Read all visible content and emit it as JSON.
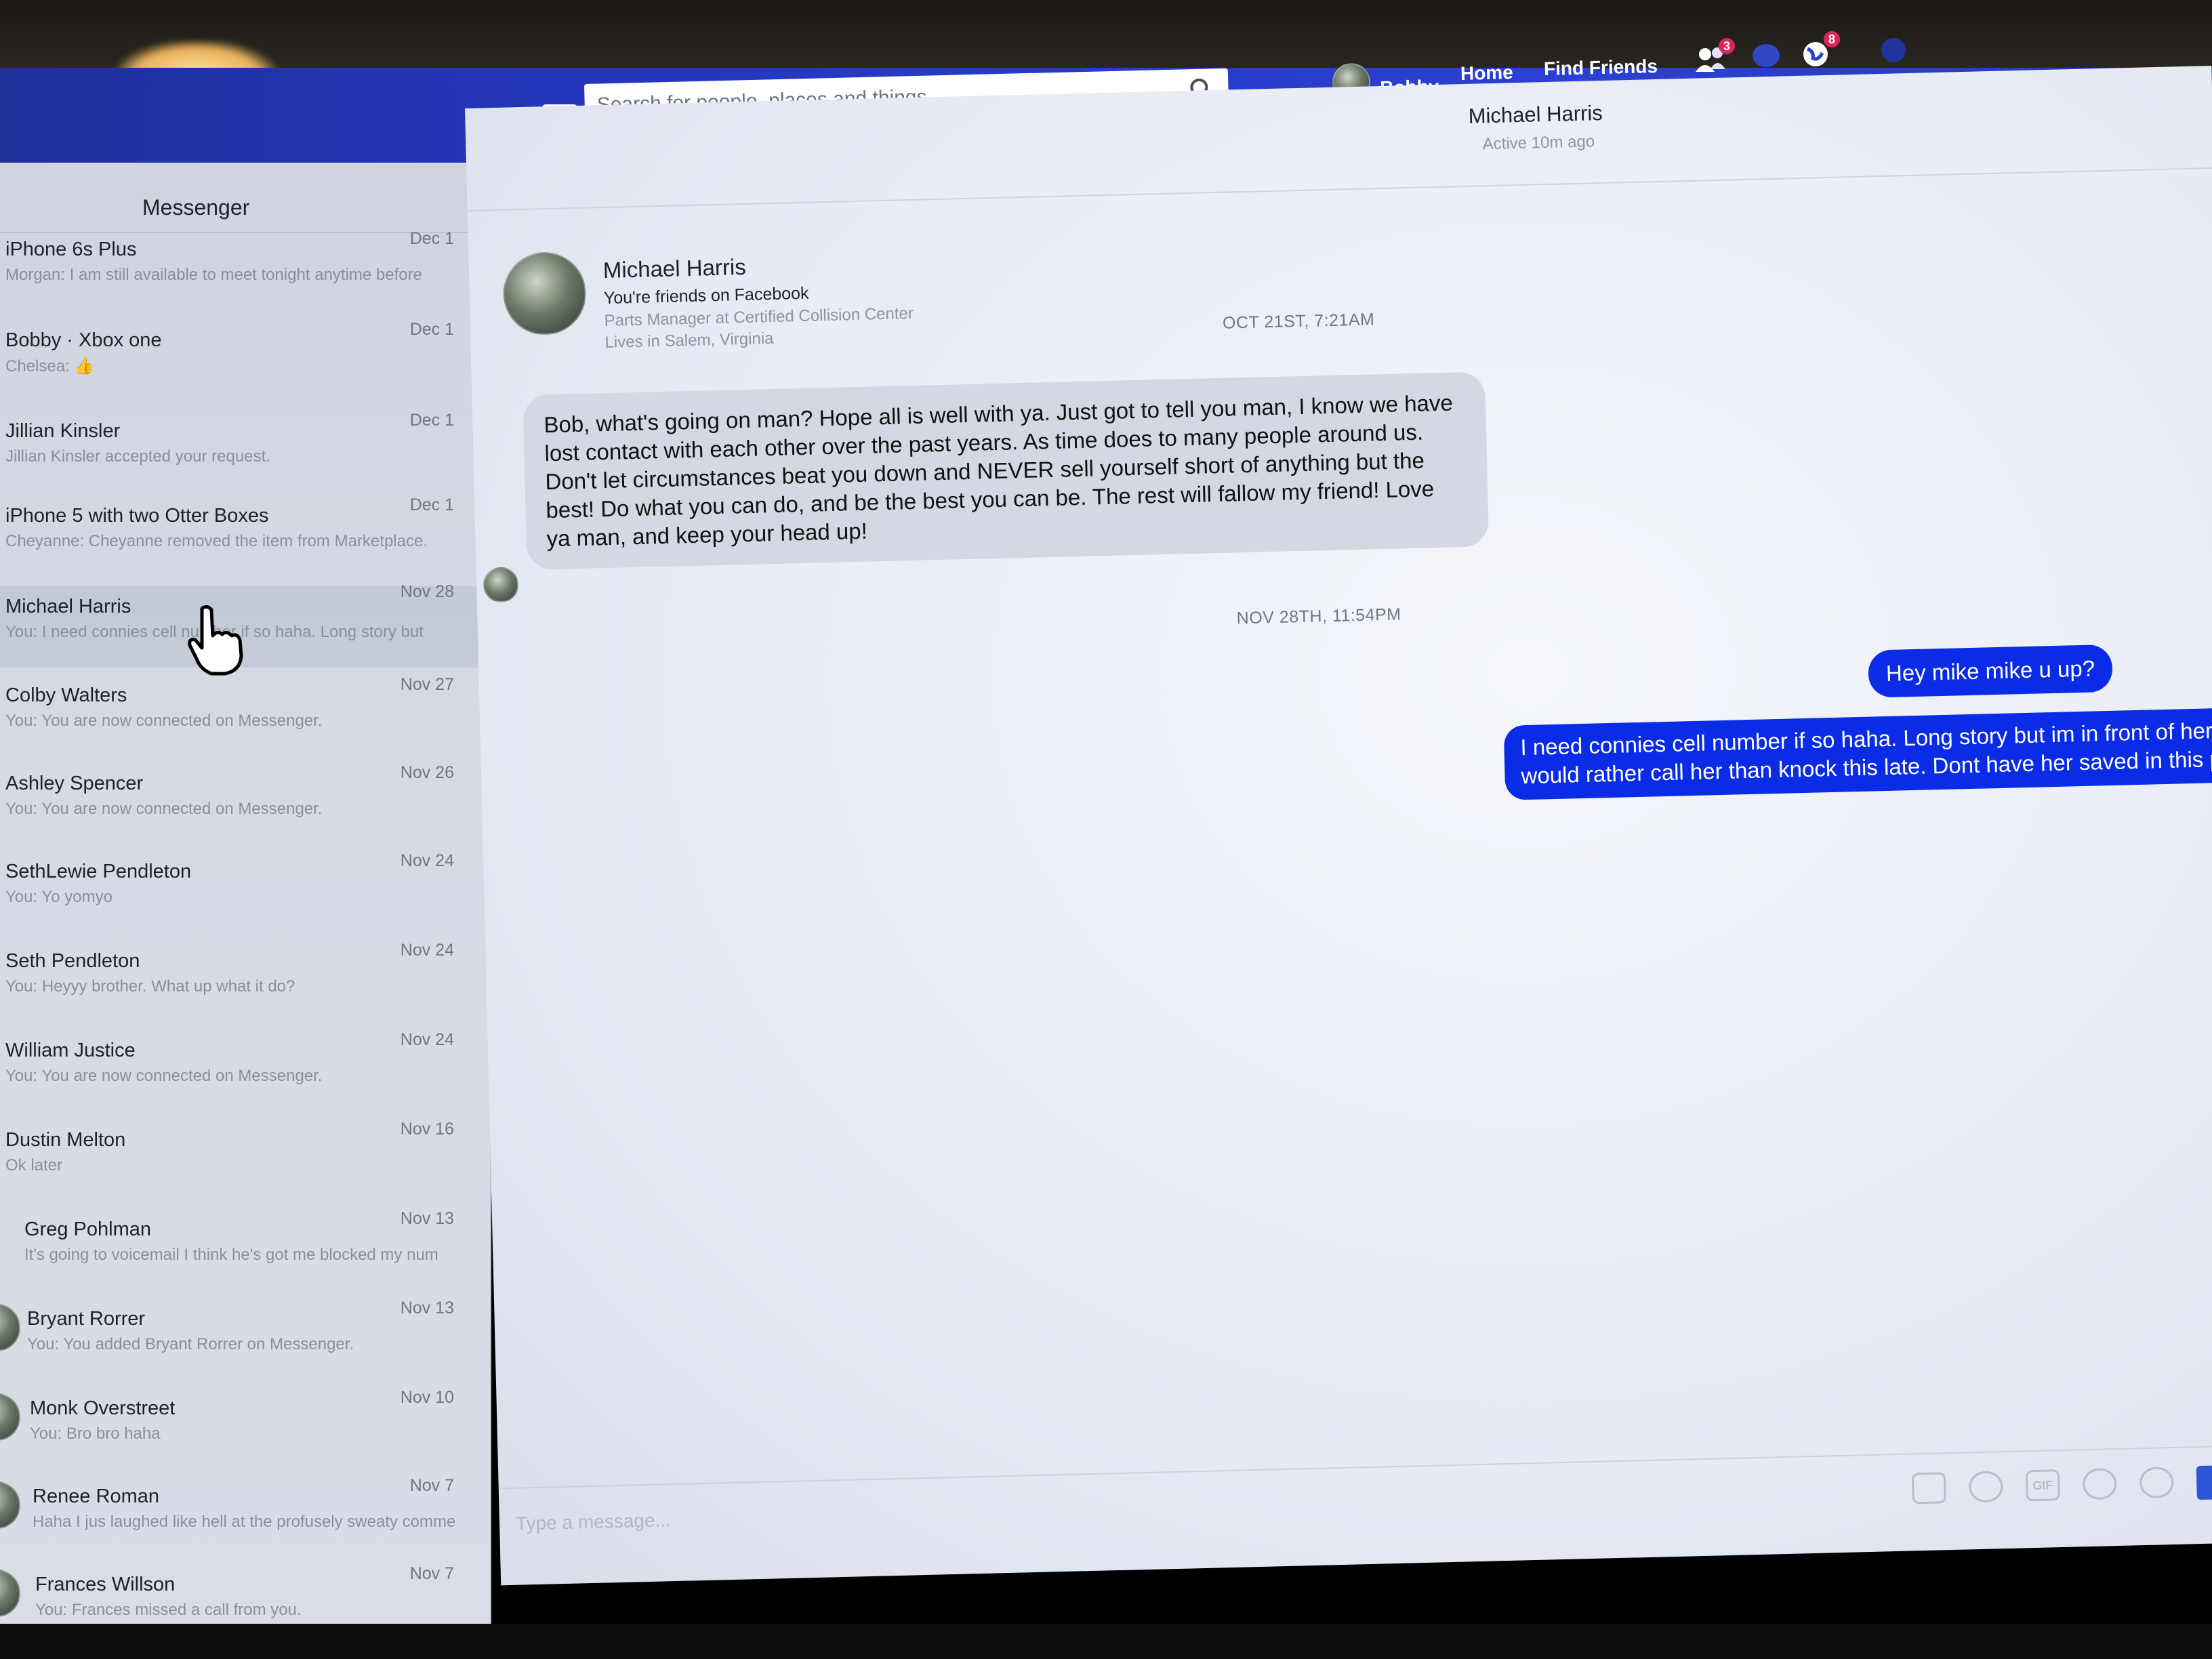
{
  "topbar": {
    "search_placeholder": "Search for people, places and things",
    "user_name": "Bobby",
    "home_label": "Home",
    "find_friends_label": "Find Friends",
    "friends_badge": "3",
    "globe_badge": "8"
  },
  "sidebar": {
    "title": "Messenger",
    "conversations": [
      {
        "name": "iPhone 6s Plus",
        "snippet": "Morgan: I am still available to meet tonight anytime before",
        "date": "Dec 1"
      },
      {
        "name": "Bobby · Xbox one",
        "snippet": "Chelsea:",
        "date": "Dec 1"
      },
      {
        "name": "Jillian Kinsler",
        "snippet": "Jillian Kinsler accepted your request.",
        "date": "Dec 1"
      },
      {
        "name": "iPhone 5 with two Otter Boxes",
        "snippet": "Cheyanne: Cheyanne removed the item from Marketplace.",
        "date": "Dec 1"
      },
      {
        "name": "Michael Harris",
        "snippet": "You: I need connies cell number if so haha. Long story but",
        "date": "Nov 28"
      },
      {
        "name": "Colby Walters",
        "snippet": "You: You are now connected on Messenger.",
        "date": "Nov 27"
      },
      {
        "name": "Ashley Spencer",
        "snippet": "You: You are now connected on Messenger.",
        "date": "Nov 26"
      },
      {
        "name": "SethLewie Pendleton",
        "snippet": "You: Yo yomyo",
        "date": "Nov 24"
      },
      {
        "name": "Seth Pendleton",
        "snippet": "You: Heyyy brother. What up what it do?",
        "date": "Nov 24"
      },
      {
        "name": "William Justice",
        "snippet": "You: You are now connected on Messenger.",
        "date": "Nov 24"
      },
      {
        "name": "Dustin Melton",
        "snippet": "Ok later",
        "date": "Nov 16"
      },
      {
        "name": "Greg Pohlman",
        "snippet": "It's going to voicemail I think he's got me blocked my num",
        "date": "Nov 13"
      },
      {
        "name": "Bryant Rorrer",
        "snippet": "You: You added Bryant Rorrer on Messenger.",
        "date": "Nov 13"
      },
      {
        "name": "Monk Overstreet",
        "snippet": "You: Bro bro haha",
        "date": "Nov 10"
      },
      {
        "name": "Renee Roman",
        "snippet": "Haha I jus laughed like hell at the profusely sweaty comme",
        "date": "Nov 7"
      },
      {
        "name": "Frances Willson",
        "snippet": "You: Frances missed a call from you.",
        "date": "Nov 7"
      }
    ]
  },
  "conversation": {
    "name": "Michael Harris",
    "status": "Active 10m ago",
    "profile": {
      "name": "Michael Harris",
      "friends": "You're friends on Facebook",
      "work": "Parts Manager at Certified Collision Center",
      "home": "Lives in Salem, Virginia"
    },
    "stamp1": "OCT 21ST, 7:21AM",
    "incoming": "Bob, what's going on man? Hope all is well with ya. Just got to tell you man, I know we have lost contact with each other over the past years. As time does to many people around us. Don't let circumstances beat you down and NEVER sell yourself short of anything but the best! Do what you can do, and be the best you can be. The rest will fallow my friend! Love ya man, and keep your head up!",
    "stamp2": "NOV 28TH, 11:54PM",
    "outgoing1": "Hey mike mike u up?",
    "outgoing2": "I need connies cell number if so haha. Long story but im in front of her house w a dead car battery and would rather call her than knock this late. Dont have her saved in this phone yet..",
    "composer_placeholder": "Type a message...",
    "tools": {
      "gif": "GIF"
    }
  },
  "colors": {
    "brand_blue": "#2b3fd2",
    "outgoing_bubble": "#0a2ce6",
    "incoming_bubble": "#d3d8e2",
    "badge_red": "#e0245e"
  },
  "icons": [
    "facebook-logo-icon",
    "search-icon",
    "friend-requests-icon",
    "messages-icon",
    "notifications-globe-icon",
    "help-icon",
    "like-icon",
    "photo-icon",
    "sticker-icon",
    "gif-icon",
    "emoji-icon",
    "payment-icon",
    "hand-cursor-icon"
  ]
}
